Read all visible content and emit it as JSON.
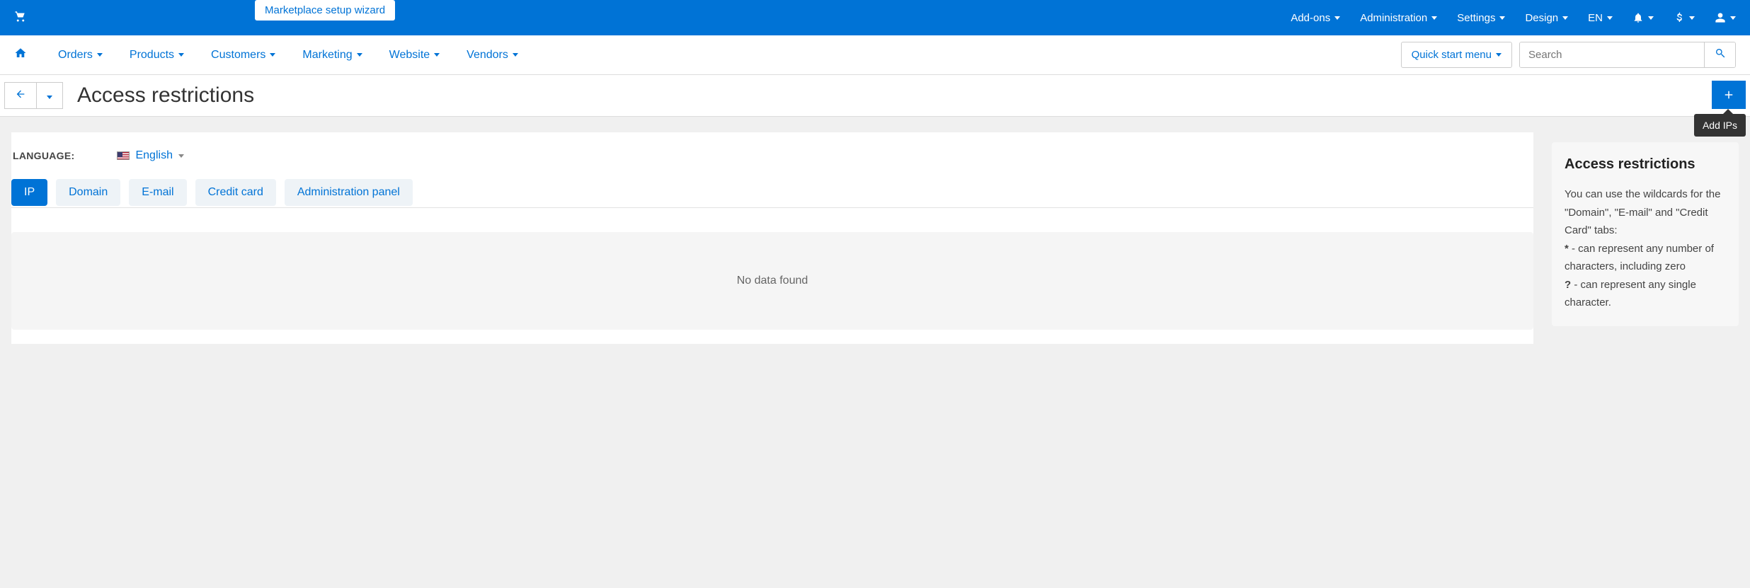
{
  "topbar": {
    "setup_wizard": "Marketplace setup wizard",
    "menu": {
      "addons": "Add-ons",
      "administration": "Administration",
      "settings": "Settings",
      "design": "Design",
      "lang": "EN"
    }
  },
  "navbar": {
    "orders": "Orders",
    "products": "Products",
    "customers": "Customers",
    "marketing": "Marketing",
    "website": "Website",
    "vendors": "Vendors",
    "quick_start": "Quick start menu",
    "search_placeholder": "Search"
  },
  "page": {
    "title": "Access restrictions",
    "add_tooltip": "Add IPs"
  },
  "language": {
    "label": "LANGUAGE:",
    "value": "English"
  },
  "tabs": {
    "ip": "IP",
    "domain": "Domain",
    "email": "E-mail",
    "credit_card": "Credit card",
    "admin_panel": "Administration panel"
  },
  "main": {
    "no_data": "No data found"
  },
  "help": {
    "title": "Access restrictions",
    "intro": "You can use the wildcards for the \"Domain\", \"E-mail\" and \"Credit Card\" tabs:",
    "star": "*",
    "star_text": " - can represent any number of characters, including zero",
    "qmark": "?",
    "qmark_text": " - can represent any single character."
  }
}
